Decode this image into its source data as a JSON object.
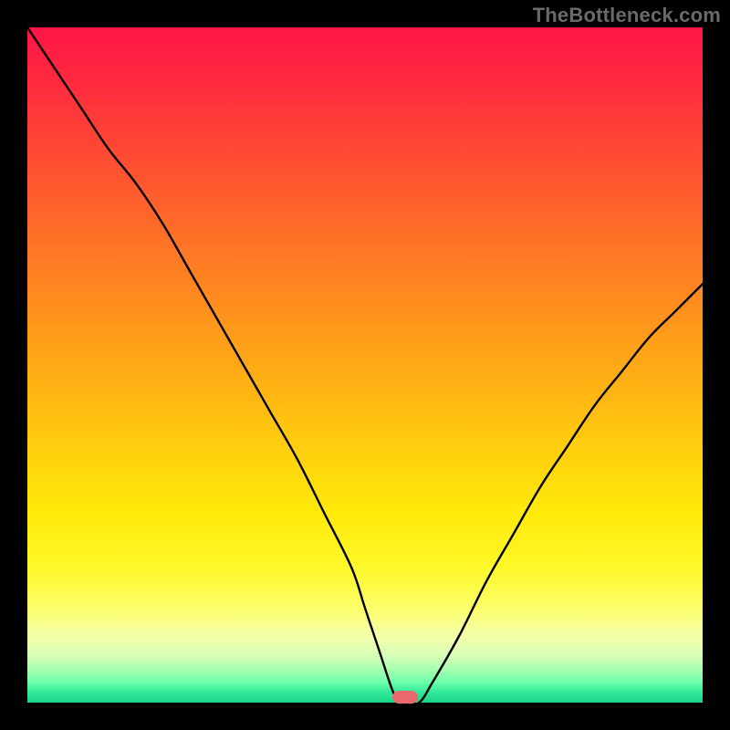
{
  "watermark": "TheBottleneck.com",
  "chart_data": {
    "type": "line",
    "title": "",
    "xlabel": "",
    "ylabel": "",
    "xlim": [
      0,
      100
    ],
    "ylim": [
      0,
      100
    ],
    "grid": false,
    "x": [
      0,
      4,
      8,
      12,
      16,
      20,
      24,
      28,
      32,
      36,
      40,
      44,
      48,
      50,
      52,
      54,
      55,
      56,
      58,
      60,
      64,
      68,
      72,
      76,
      80,
      84,
      88,
      92,
      96,
      100
    ],
    "values": [
      100,
      94,
      88,
      82,
      77,
      71,
      64,
      57,
      50,
      43,
      36,
      28,
      20,
      14,
      8,
      2,
      0,
      0,
      0,
      3,
      10,
      18,
      25,
      32,
      38,
      44,
      49,
      54,
      58,
      62
    ],
    "minimum_marker": {
      "x": 56,
      "y": 0
    },
    "gradient_colors": {
      "top": "#ff1547",
      "mid": "#ffea0a",
      "bottom": "#1cd488"
    }
  }
}
